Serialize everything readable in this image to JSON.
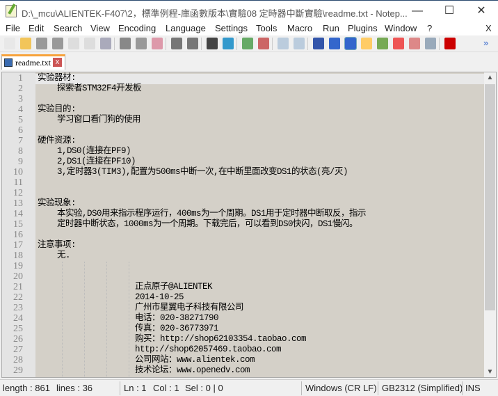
{
  "window": {
    "title": "D:\\_mcu\\ALIENTEK-F407\\2，標準例程-庫函數版本\\實驗08 定時器中斷實驗\\readme.txt - Notep...",
    "minimize": "—",
    "maximize": "☐",
    "close": "✕"
  },
  "menu": [
    "File",
    "Edit",
    "Search",
    "View",
    "Encoding",
    "Language",
    "Settings",
    "Tools",
    "Macro",
    "Run",
    "Plugins",
    "Window",
    "?"
  ],
  "menu_close": "X",
  "toolbar": {
    "icons": [
      "new-file",
      "open-file",
      "save",
      "save-all",
      "close",
      "close-all",
      "print",
      "cut",
      "copy",
      "paste",
      "undo",
      "redo",
      "find",
      "replace",
      "zoom-in",
      "zoom-out",
      "sync-vertical",
      "sync-horizontal",
      "word-wrap",
      "show-all-chars",
      "indent-guide",
      "udl",
      "doc-map",
      "function-list",
      "folder-workspace",
      "monitor",
      "record-macro"
    ],
    "overflow": "»"
  },
  "tab": {
    "label": "readme.txt",
    "close": "x"
  },
  "editor": {
    "lines": [
      "实验器材:",
      "    探索者STM32F4开发板",
      "",
      "实验目的:",
      "    学习窗口看门狗的使用",
      "",
      "硬件资源:",
      "    1,DS0(连接在PF9)",
      "    2,DS1(连接在PF10)",
      "    3,定时器3(TIM3),配置为500ms中断一次,在中断里面改变DS1的状态(亮/灭)",
      "",
      "",
      "实验现象:",
      "    本实验,DS0用来指示程序运行，400ms为一个周期。DS1用于定时器中断取反，指示",
      "    定时器中断状态，1000ms为一个周期。下载完后，可以看到DS0快闪，DS1慢闪。",
      "",
      "注意事项:",
      "    无.",
      "",
      "",
      "                    正点原子@ALIENTEK",
      "                    2014-10-25",
      "                    广州市星翼电子科技有限公司",
      "                    电话：020-38271790",
      "                    传真：020-36773971",
      "                    购买：http://shop62103354.taobao.com",
      "                    http://shop62057469.taobao.com",
      "                    公司网站：www.alientek.com",
      "                    技术论坛：www.openedv.com"
    ]
  },
  "status": {
    "length": "length : 861",
    "lines": "lines : 36",
    "ln": "Ln : 1",
    "col": "Col : 1",
    "sel": "Sel : 0 | 0",
    "eol": "Windows (CR LF)",
    "encoding": "GB2312 (Simplified)",
    "mode": "INS"
  }
}
